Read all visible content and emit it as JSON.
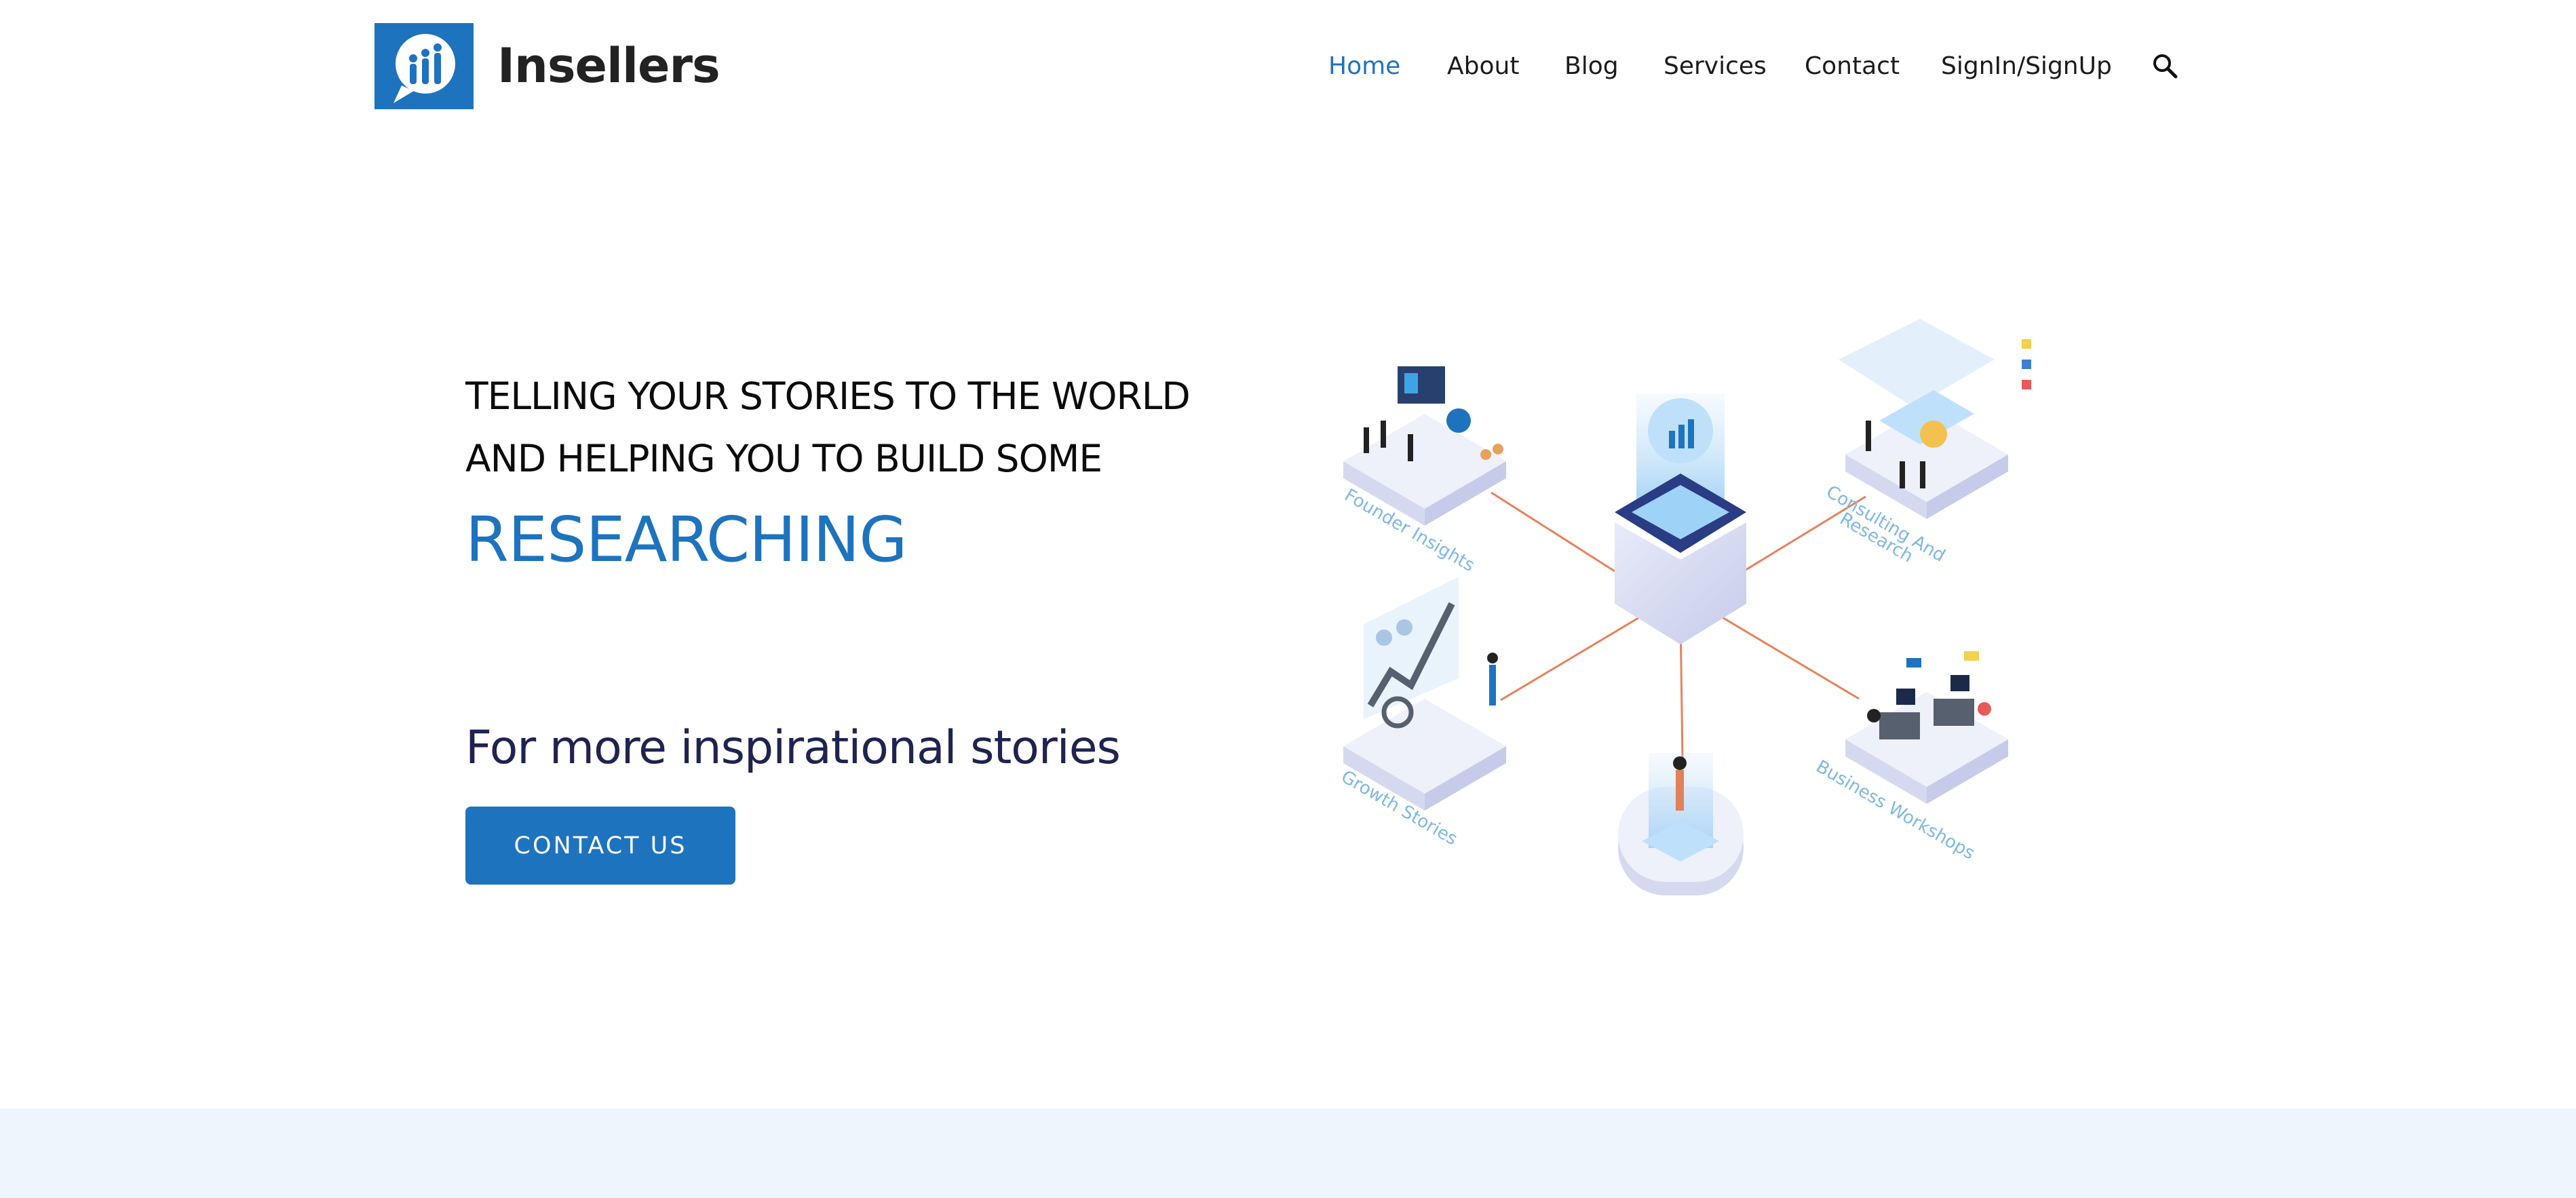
{
  "brand": {
    "name": "Insellers"
  },
  "nav": {
    "items": [
      {
        "label": "Home",
        "active": true
      },
      {
        "label": "About",
        "active": false
      },
      {
        "label": "Blog",
        "active": false
      },
      {
        "label": "Services",
        "active": false
      },
      {
        "label": "Contact",
        "active": false
      },
      {
        "label": "SignIn/SignUp",
        "active": false
      }
    ],
    "search_icon": "search-icon"
  },
  "hero": {
    "line1": "TELLING YOUR STORIES TO THE WORLD",
    "line2": "AND HELPING YOU TO BUILD SOME",
    "highlight": "RESEARCHING",
    "subtitle": "For more inspirational stories",
    "cta_label": "CONTACT US"
  },
  "illustration": {
    "labels": [
      "Founder Insights",
      "Consulting And",
      "Research",
      "Growth Stories",
      "Business Workshops"
    ]
  },
  "colors": {
    "accent": "#1e73be",
    "heading_dark": "#1f2350",
    "band": "#eef5fc",
    "connector": "#e8825a"
  }
}
